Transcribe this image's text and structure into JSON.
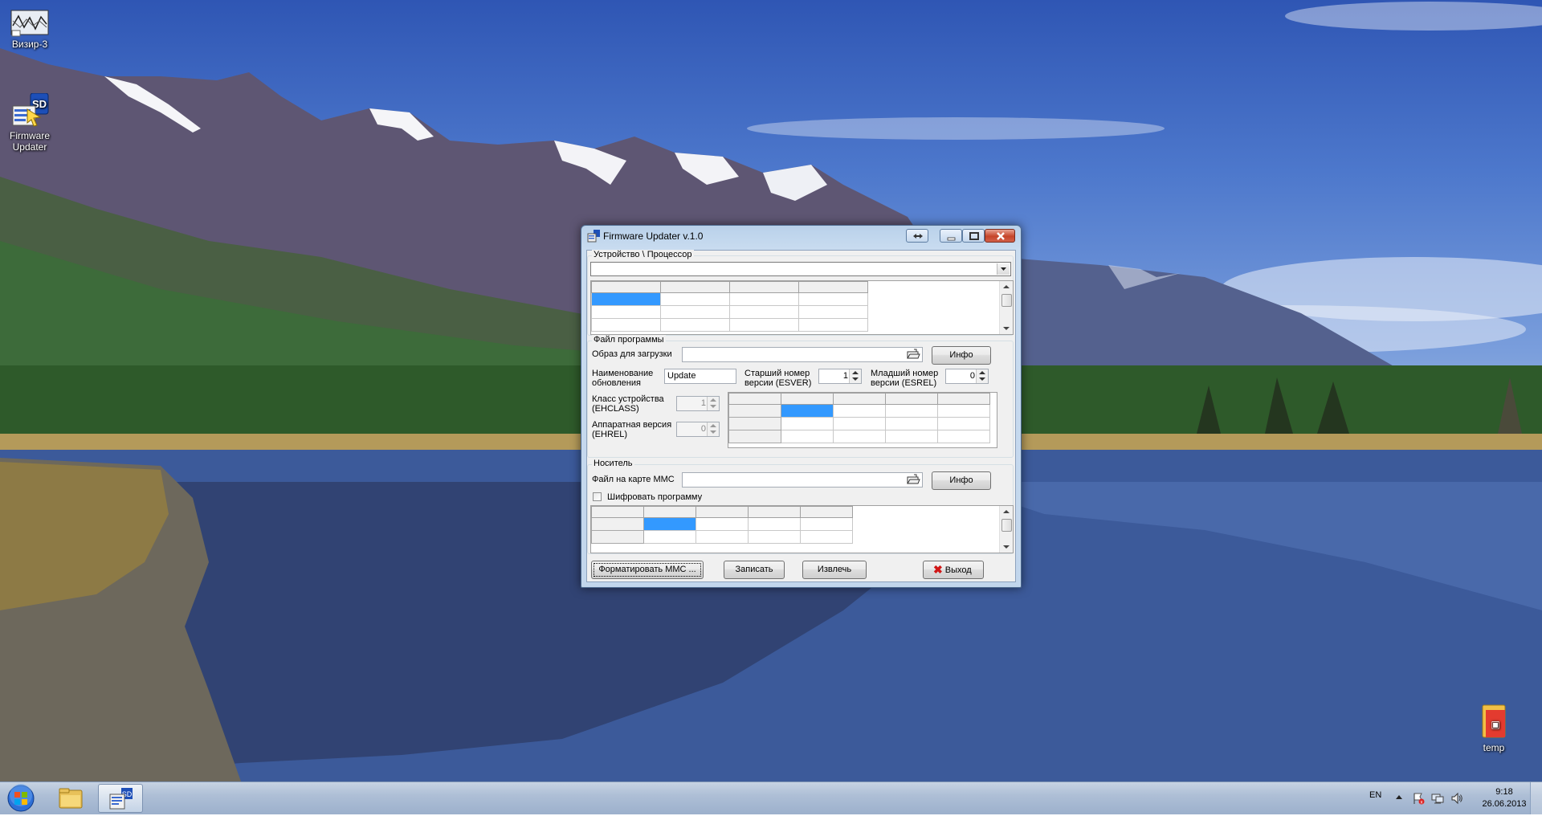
{
  "desktop": {
    "icons": [
      {
        "label": "Визир-3"
      },
      {
        "label": "Firmware Updater"
      },
      {
        "label": "temp"
      }
    ]
  },
  "window": {
    "title": "Firmware Updater v.1.0",
    "device_group": {
      "legend": "Устройство \\ Процессор",
      "combo_value": ""
    },
    "program_group": {
      "legend": "Файл программы",
      "image_label": "Образ для загрузки",
      "image_value": "",
      "info_button": "Инфо",
      "update_name_label": "Наименование обновления",
      "update_name_value": "Update",
      "major_version_label": "Старший номер версии (ESVER)",
      "major_version_value": "1",
      "minor_version_label": "Младший номер версии (ESREL)",
      "minor_version_value": "0",
      "device_class_label": "Класс устройства (EHCLASS)",
      "device_class_value": "1",
      "hw_version_label": "Аппаратная версия (EHREL)",
      "hw_version_value": "0"
    },
    "media_group": {
      "legend": "Носитель",
      "mmc_file_label": "Файл на карте MMC",
      "mmc_file_value": "",
      "info_button": "Инфо",
      "encrypt_label": "Шифровать программу",
      "encrypt_checked": false
    },
    "buttons": {
      "format": "Форматировать MMC ...",
      "write": "Записать",
      "extract": "Извлечь",
      "exit": "Выход"
    }
  },
  "taskbar": {
    "language": "EN",
    "time": "9:18",
    "date": "26.06.2013"
  },
  "colors": {
    "selection": "#3399ff",
    "window_frame": "#c2d6ec",
    "taskbar": "#aebfd6"
  }
}
